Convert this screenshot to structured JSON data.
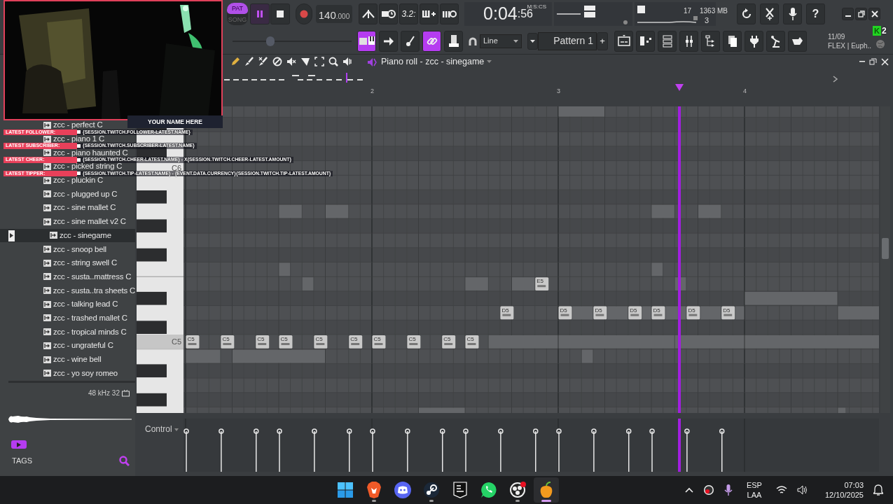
{
  "toolbar": {
    "mode_switch": [
      {
        "label": "PAT",
        "selected": true
      },
      {
        "label": "SONG",
        "selected": false
      }
    ],
    "transport": [
      {
        "kind": "pause",
        "on": true
      },
      {
        "kind": "stop",
        "on": false
      },
      {
        "kind": "record",
        "on": false
      }
    ],
    "tempo": "140",
    "tempo_decimals": ".000",
    "countdown_label": "3.2:",
    "time": "0:04",
    "time_centiseconds": ":56",
    "time_format": "M:S:CS",
    "cpu": "17",
    "memory": "1363 MB",
    "polyphony": "3",
    "help_label": "?",
    "master_pitch": {
      "level": 0.32
    },
    "mode_buttons": [
      {
        "on": true
      },
      {
        "on": false
      },
      {
        "on": false
      },
      {
        "on": true
      },
      {
        "on": false
      }
    ],
    "snap": "Line",
    "pattern": "Pattern 1",
    "add_pattern": "+",
    "hint_date": "11/09",
    "hint_text": "FLEX | Euph..",
    "notification": {
      "letter": "K",
      "count": "2"
    }
  },
  "browser": {
    "items": [
      {
        "label": "zcc - perfect C",
        "selected": false
      },
      {
        "label": "zcc - piano 1 C",
        "selected": false
      },
      {
        "label": "zcc - piano haunted C",
        "selected": false
      },
      {
        "label": "zcc - picked string C",
        "selected": false
      },
      {
        "label": "zcc - pluckin C",
        "selected": false
      },
      {
        "label": "zcc - plugged up C",
        "selected": false
      },
      {
        "label": "zcc - sine mallet C",
        "selected": false
      },
      {
        "label": "zcc - sine mallet v2 C",
        "selected": false
      },
      {
        "label": "zcc - sinegame",
        "selected": true
      },
      {
        "label": "zcc - snoop bell",
        "selected": false
      },
      {
        "label": "zcc - string swell C",
        "selected": false
      },
      {
        "label": "zcc - susta..mattress C",
        "selected": false
      },
      {
        "label": "zcc - susta..tra sheets C",
        "selected": false
      },
      {
        "label": "zcc - talking lead C",
        "selected": false
      },
      {
        "label": "zcc - trashed mallet C",
        "selected": false
      },
      {
        "label": "zcc - tropical minds C",
        "selected": false
      },
      {
        "label": "zcc - ungrateful C",
        "selected": false
      },
      {
        "label": "zcc - wine bell",
        "selected": false
      },
      {
        "label": "zcc - yo soy romeo",
        "selected": false
      }
    ],
    "sample_info": "48 kHz 32",
    "tags_label": "TAGS"
  },
  "piano_roll": {
    "title": "Piano roll - zcc - sinegame",
    "bars": [
      "2",
      "3",
      "4"
    ],
    "key_labels": [
      "C6",
      "C5"
    ],
    "playhead": {
      "level": 0.713
    },
    "notes": [
      {
        "label": "C5"
      },
      {
        "label": "C5"
      },
      {
        "label": "C5"
      },
      {
        "label": "C5"
      },
      {
        "label": "C5"
      },
      {
        "label": "C5"
      },
      {
        "label": "C5"
      },
      {
        "label": "C5"
      },
      {
        "label": "C5"
      },
      {
        "label": "C5"
      },
      {
        "label": "D5"
      },
      {
        "label": "D5"
      },
      {
        "label": "D5"
      },
      {
        "label": "D5"
      },
      {
        "label": "D5"
      },
      {
        "label": "D5"
      },
      {
        "label": "D5"
      },
      {
        "label": "E5"
      }
    ],
    "control_label": "Control"
  },
  "overlay": {
    "name_tag": "YOUR NAME HERE",
    "alerts": [
      {
        "label": "LATEST FOLLOWER:",
        "value": "{SESSION.TWITCH.FOLLOWER-LATEST.NAME}"
      },
      {
        "label": "LATEST SUBSCRIBER:",
        "value": "{SESSION.TWITCH.SUBSCRIBER-LATEST.NAME}"
      },
      {
        "label": "LATEST CHEER:",
        "value": "{SESSION.TWITCH.CHEER-LATEST.NAME} - X{SESSION.TWITCH.CHEER-LATEST.AMOUNT}"
      },
      {
        "label": "LATEST TIPPER:",
        "value": "{SESSION.TWITCH.TIP-LATEST.NAME} - {EVENT.DATA.CURRENCY}{SESSION.TWITCH.TIP-LATEST.AMOUNT}"
      }
    ]
  },
  "taskbar": {
    "apps": [
      {
        "running": false,
        "focused": false
      },
      {
        "running": true,
        "focused": false
      },
      {
        "running": false,
        "focused": false
      },
      {
        "running": true,
        "focused": false
      },
      {
        "running": false,
        "focused": false
      },
      {
        "running": false,
        "focused": false
      },
      {
        "running": true,
        "focused": false
      },
      {
        "running": true,
        "focused": true
      }
    ],
    "language": "ESP",
    "region": "LAA",
    "time": "07:03",
    "date": "12/10/2025"
  }
}
